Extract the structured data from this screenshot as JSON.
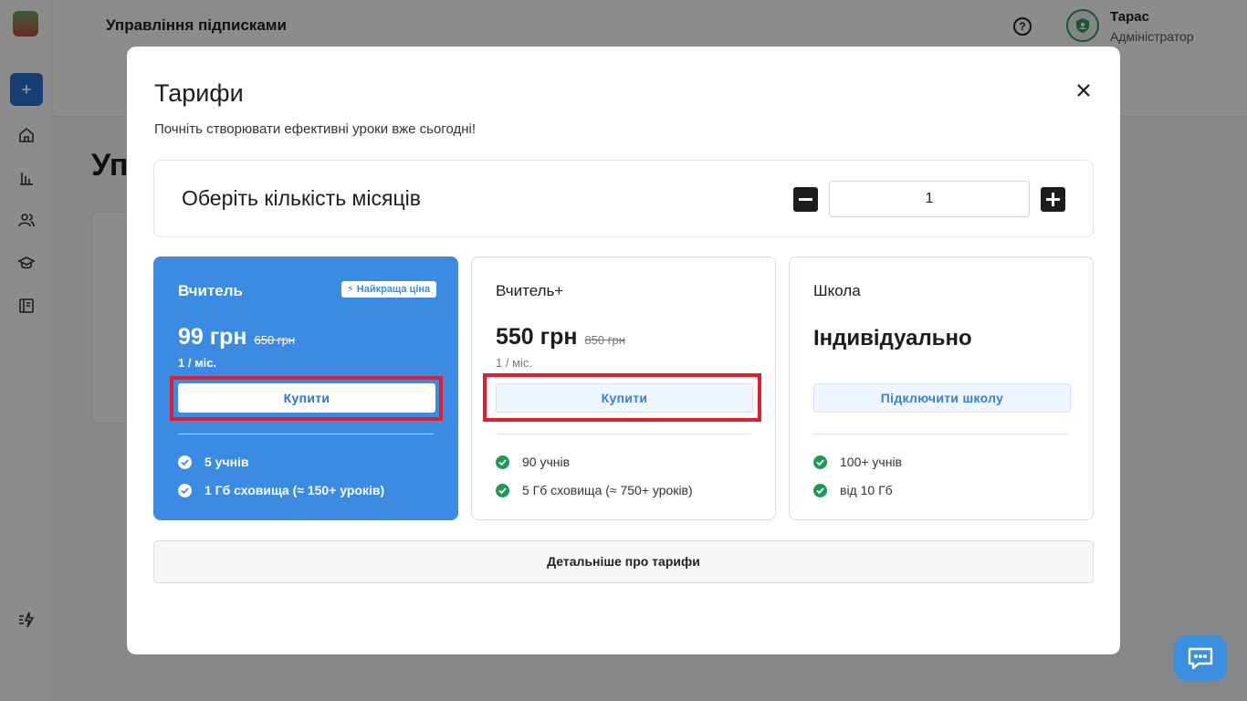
{
  "app": {
    "page_heading": "Управління підписками",
    "user_name": "Тарас",
    "user_role": "Адміністратор",
    "help_glyph": "?",
    "add_glyph": "+",
    "bg_title": "Уп"
  },
  "modal": {
    "title": "Тарифи",
    "subtitle": "Почніть створювати ефективні уроки вже сьогодні!",
    "months_label": "Оберіть кількість місяців",
    "months_value": "1",
    "details_label": "Детальніше про тарифи"
  },
  "plans": [
    {
      "name": "Вчитель",
      "badge": "Найкраща ціна",
      "price": "99 грн",
      "old_price": "650 грн",
      "period": "1 / міс.",
      "button": "Купити",
      "features": [
        "5 учнів",
        "1 Гб сховища (≈ 150+ уроків)"
      ]
    },
    {
      "name": "Вчитель+",
      "price": "550 грн",
      "old_price": "850 грн",
      "period": "1 / міс.",
      "button": "Купити",
      "features": [
        "90 учнів",
        "5 Гб сховища (≈ 750+ уроків)"
      ]
    },
    {
      "name": "Школа",
      "price_text": "Індивідуально",
      "button": "Підключити школу",
      "features": [
        "100+ учнів",
        "від 10 Гб"
      ]
    }
  ],
  "colors": {
    "accent": "#3b8be2",
    "check_green": "#1f9a55",
    "highlight_red": "#e01e2d",
    "overlay": "rgba(0,0,0,0.45)"
  }
}
